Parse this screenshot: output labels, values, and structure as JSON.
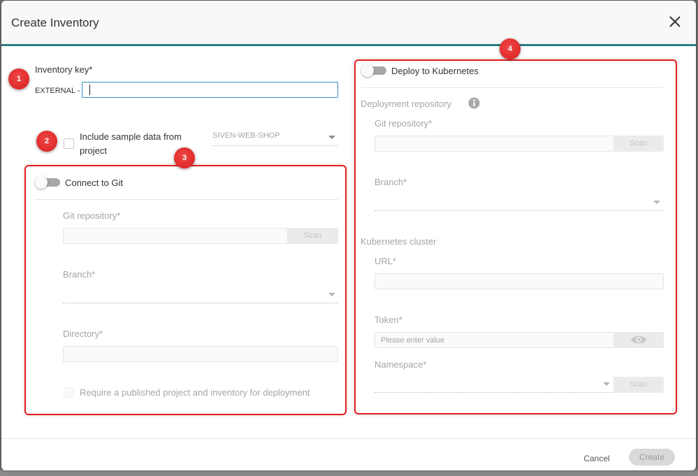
{
  "dialog": {
    "title": "Create Inventory",
    "close_icon": "close-icon",
    "accent_color": "#2f7d80"
  },
  "inventory_key": {
    "label": "Inventory key*",
    "prefix": "EXTERNAL -",
    "value": ""
  },
  "sample_data": {
    "label_line1": "Include sample data from",
    "label_line2": "project",
    "checked": false,
    "project_select_value": "SIVEN-WEB-SHOP"
  },
  "git_section": {
    "toggle_label": "Connect to Git",
    "enabled": false,
    "git_repository_label": "Git repository*",
    "git_repository_value": "",
    "scan_label": "Scan",
    "branch_label": "Branch*",
    "branch_value": "",
    "directory_label": "Directory*",
    "directory_value": "",
    "require_published_label": "Require a published project and inventory for deployment",
    "require_published_checked": false
  },
  "kubernetes_section": {
    "toggle_label": "Deploy to Kubernetes",
    "enabled": false,
    "deployment_repository_heading": "Deployment repository",
    "git_repository_label": "Git repository*",
    "git_repository_value": "",
    "scan_label": "Scan",
    "branch_label": "Branch*",
    "branch_value": "",
    "cluster_heading": "Kubernetes cluster",
    "url_label": "URL*",
    "url_value": "",
    "token_label": "Token*",
    "token_placeholder": "Please enter value",
    "namespace_label": "Namespace*",
    "namespace_value": "",
    "namespace_scan_label": "Scan"
  },
  "footer": {
    "cancel_label": "Cancel",
    "create_label": "Create"
  },
  "annotations": {
    "marker_color": "#e51d1d",
    "markers": [
      "1",
      "2",
      "3",
      "4"
    ]
  }
}
